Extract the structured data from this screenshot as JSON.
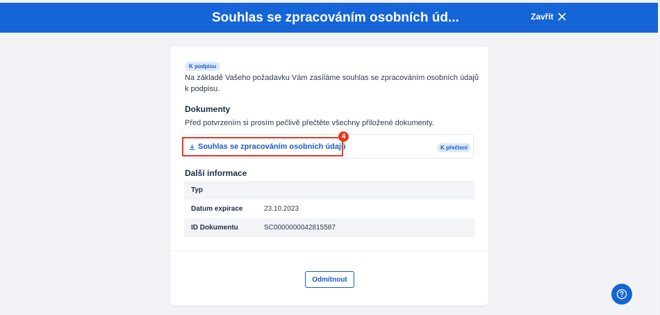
{
  "header": {
    "title": "Souhlas se zpracováním osobních úd...",
    "close_label": "Zavřít"
  },
  "card": {
    "status_badge": "K podpisu",
    "intro_text": "Na základě Vašeho požadavku Vám zasíláme souhlas se zpracováním osobních údajů k podpisu.",
    "documents": {
      "heading": "Dokumenty",
      "note": "Před potvrzením si prosím pečlivě přečtěte všechny přiložené dokumenty.",
      "items": [
        {
          "label": "Souhlas se zpracováním osobních údajů",
          "badge": "K přečtení"
        }
      ],
      "marker": "4"
    },
    "info": {
      "heading": "Další informace",
      "rows": [
        {
          "key": "Typ",
          "value": ""
        },
        {
          "key": "Datum expirace",
          "value": "23.10.2023"
        },
        {
          "key": "ID Dokumentu",
          "value": "SC0000000042815587"
        }
      ]
    },
    "reject_label": "Odmítnout"
  },
  "colors": {
    "primary": "#1565d8",
    "link": "#1a5cc4",
    "highlight": "#e53a1f",
    "badge_bg": "#dce9fb"
  },
  "icons": {
    "close": "close-icon",
    "download": "download-icon",
    "help": "help-icon"
  }
}
